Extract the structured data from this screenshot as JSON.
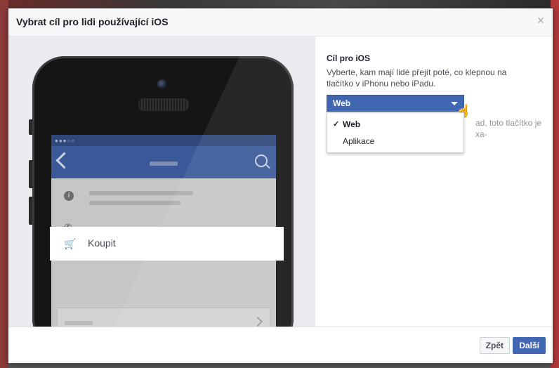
{
  "dialog": {
    "title": "Vybrat cíl pro lidi používající iOS",
    "close_glyph": "×"
  },
  "preview": {
    "status_glyphs": "●●●○○",
    "info_glyph": "i",
    "phone_glyph": "✆",
    "cart_glyph": "🛒",
    "buy_label": "Koupit"
  },
  "destination": {
    "label": "Cíl pro iOS",
    "description": "Vyberte, kam mají lidé přejít poté, co klepnou na tlačítko v iPhonu nebo iPadu.",
    "selected": "Web",
    "options": [
      {
        "label": "Web",
        "checked": true
      },
      {
        "label": "Aplikace",
        "checked": false
      }
    ],
    "check_glyph": "✓",
    "obscured_text": "ad, toto tlačítko je\nxa-"
  },
  "footer": {
    "back_label": "Zpět",
    "next_label": "Další"
  },
  "colors": {
    "primary": "#4267b2",
    "navbar": "#3b5998"
  }
}
